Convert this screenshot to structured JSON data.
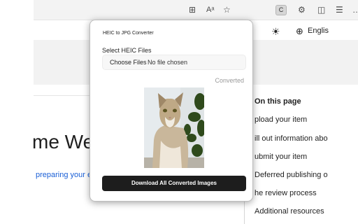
{
  "browser": {
    "toolbar_icons": [
      "grid-icon",
      "read-aloud-icon",
      "favorite-star-icon",
      "extension-icon",
      "settings-gear-icon",
      "split-screen-icon",
      "favorites-icon",
      "more-icon"
    ],
    "extension_badge": "C"
  },
  "page": {
    "language": "Englis",
    "title_fragment": "me We",
    "link_fragment": "preparing your ex",
    "toc": {
      "title": "On this page",
      "items": [
        "pload your item",
        "ill out information abo",
        "ubmit your item",
        "Deferred publishing o",
        "he review process",
        "Additional resources"
      ]
    }
  },
  "popup": {
    "title": "HEIC to JPG Converter",
    "select_label": "Select HEIC Files",
    "choose_button": "Choose Files",
    "no_file_text": "No file chosen",
    "converted_label": "Converted",
    "download_button": "Download All Converted Images",
    "image_subject": "cat-photo"
  }
}
